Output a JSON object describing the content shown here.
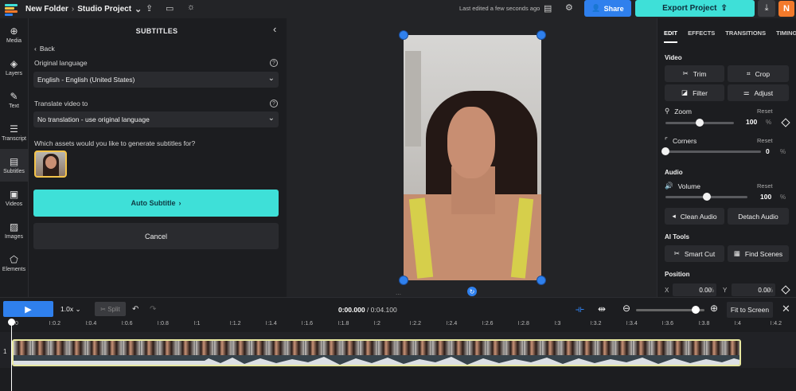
{
  "topbar": {
    "folder": "New Folder",
    "separator": "›",
    "project": "Studio Project",
    "last_edited": "Last edited a few seconds ago",
    "share_label": "Share",
    "export_label": "Export Project",
    "avatar_initial": "N"
  },
  "left_nav": [
    {
      "label": "Media",
      "icon": "media-icon"
    },
    {
      "label": "Layers",
      "icon": "layers-icon"
    },
    {
      "label": "Text",
      "icon": "text-icon"
    },
    {
      "label": "Transcript",
      "icon": "transcript-icon"
    },
    {
      "label": "Subtitles",
      "icon": "subtitles-icon",
      "active": true
    },
    {
      "label": "Videos",
      "icon": "videos-icon"
    },
    {
      "label": "Images",
      "icon": "images-icon"
    },
    {
      "label": "Elements",
      "icon": "elements-icon"
    }
  ],
  "subtitles_panel": {
    "title": "SUBTITLES",
    "back_label": "Back",
    "original_language_label": "Original language",
    "original_language_value": "English - English (United States)",
    "translate_label": "Translate video to",
    "translate_value": "No translation - use original language",
    "assets_question": "Which assets would you like to generate subtitles for?",
    "auto_subtitle_label": "Auto Subtitle",
    "cancel_label": "Cancel"
  },
  "right_panel": {
    "tabs": [
      "EDIT",
      "EFFECTS",
      "TRANSITIONS",
      "TIMING"
    ],
    "active_tab": "EDIT",
    "video_section": "Video",
    "trim_label": "Trim",
    "crop_label": "Crop",
    "filter_label": "Filter",
    "adjust_label": "Adjust",
    "zoom_label": "Zoom",
    "zoom_reset": "Reset",
    "zoom_value": "100",
    "zoom_unit": "%",
    "zoom_level": 0.5,
    "corners_label": "Corners",
    "corners_reset": "Reset",
    "corners_value": "0",
    "corners_unit": "%",
    "corners_level": 0.0,
    "audio_section": "Audio",
    "volume_label": "Volume",
    "volume_reset": "Reset",
    "volume_value": "100",
    "volume_unit": "%",
    "volume_level": 0.5,
    "clean_audio_label": "Clean Audio",
    "detach_audio_label": "Detach Audio",
    "ai_tools_section": "AI Tools",
    "smart_cut_label": "Smart Cut",
    "find_scenes_label": "Find Scenes",
    "position_section": "Position",
    "pos_x_label": "X",
    "pos_x_value": "0.00",
    "pos_y_label": "Y",
    "pos_y_value": "0.00",
    "pos_unit": "%"
  },
  "timeline": {
    "speed": "1.0x",
    "split_label": "Split",
    "current_time": "0:00.000",
    "separator": " / ",
    "total_time": "0:04.100",
    "fit_label": "Fit to Screen",
    "track_number": "1",
    "ruler_labels": [
      "0",
      ":0.2",
      ":0.4",
      ":0.6",
      ":0.8",
      ":1",
      ":1.2",
      ":1.4",
      ":1.6",
      ":1.8",
      ":2",
      ":2.2",
      ":2.4",
      ":2.6",
      ":2.8",
      ":3",
      ":3.2",
      ":3.4",
      ":3.6",
      ":3.8",
      ":4",
      ":4.2"
    ],
    "zoom_level": 0.87
  },
  "colors": {
    "accent_blue": "#2f80ed",
    "accent_teal": "#3ee0d8",
    "avatar_orange": "#f37a2b",
    "clip_border": "#e8e8a0"
  }
}
